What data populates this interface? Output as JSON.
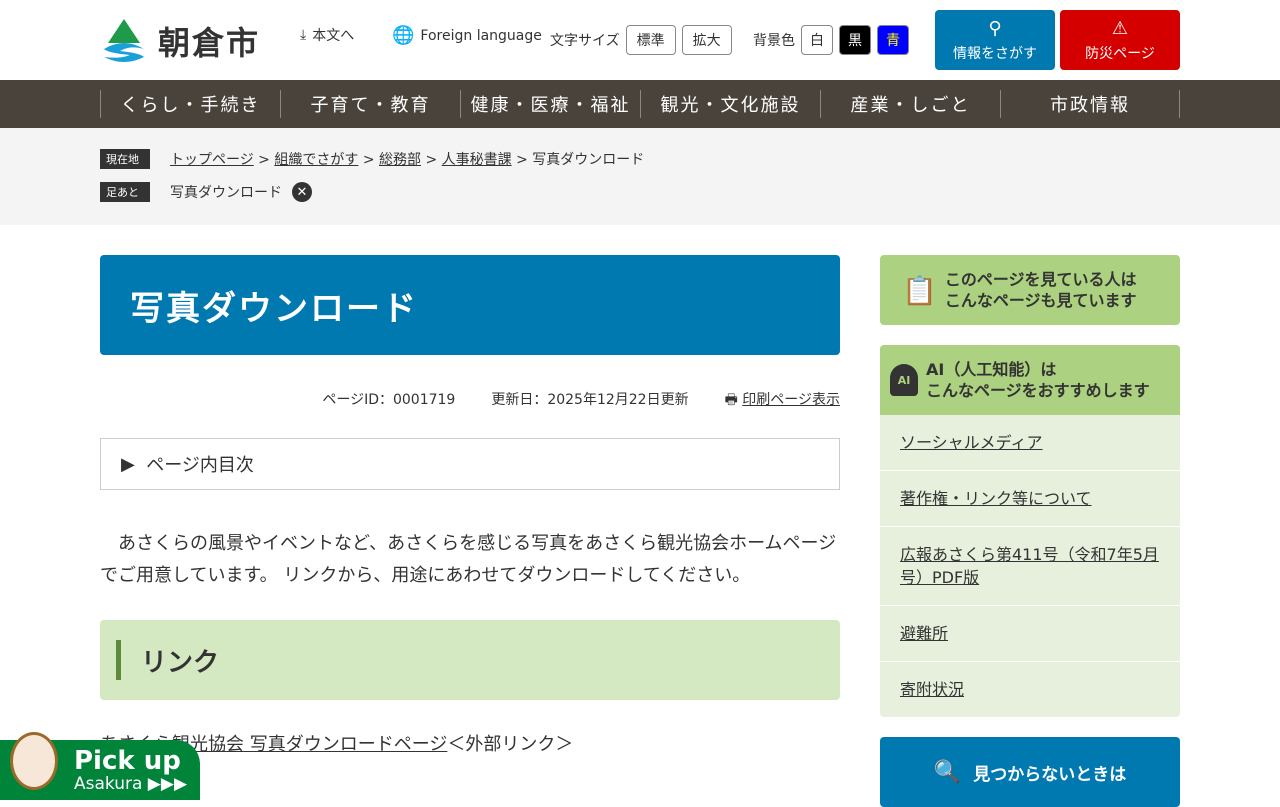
{
  "header": {
    "site_name": "朝倉市",
    "skip": "本文へ",
    "foreign": "Foreign language",
    "font_size_label": "文字サイズ",
    "font_std": "標準",
    "font_large": "拡大",
    "bg_label": "背景色",
    "bg_white": "白",
    "bg_black": "黒",
    "bg_blue": "青",
    "search": "情報をさがす",
    "disaster": "防災ページ"
  },
  "nav": [
    "くらし・手続き",
    "子育て・教育",
    "健康・医療・福祉",
    "観光・文化施設",
    "産業・しごと",
    "市政情報"
  ],
  "breadcrumb": {
    "label": "現在地",
    "items": [
      "トップページ",
      "組織でさがす",
      "総務部",
      "人事秘書課"
    ],
    "current": "写真ダウンロード",
    "footprint_label": "足あと",
    "footprint": "写真ダウンロード"
  },
  "page": {
    "title": "写真ダウンロード",
    "page_id": "ページID：0001719",
    "updated": "更新日：2025年12月22日更新",
    "print": "印刷ページ表示",
    "toc": "ページ内目次",
    "body": "　あさくらの風景やイベントなど、あさくらを感じる写真をあさくら観光協会ホームページでご用意しています。 リンクから、用途にあわせてダウンロードしてください。",
    "section": "リンク",
    "link": "あさくら観光協会 写真ダウンロードページ",
    "link_suffix": "＜外部リンク＞"
  },
  "sidebar": {
    "viewed": [
      "このページを見ている人は",
      "こんなページも見ています"
    ],
    "ai_title": [
      "AI（人工知能）は",
      "こんなページをおすすめします"
    ],
    "ai_items": [
      "ソーシャルメディア",
      "著作権・リンク等について",
      "広報あさくら第411号（令和7年5月号）PDF版",
      "避難所",
      "寄附状況"
    ],
    "not_found": "見つからないときは"
  },
  "pickup": {
    "title": "Pick up",
    "sub": "Asakura ▶▶▶"
  }
}
